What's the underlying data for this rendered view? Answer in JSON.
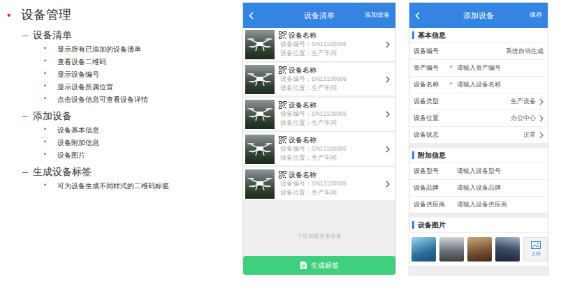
{
  "outline": {
    "bullet": "•",
    "title": "设备管理",
    "sections": [
      {
        "marker": "–",
        "title": "设备清单",
        "items": [
          {
            "bullet": "•",
            "text": "显示所有已添加的设备清单"
          },
          {
            "bullet": "•",
            "text": "查看设备二维码"
          },
          {
            "bullet": "•",
            "text": "显示设备编号"
          },
          {
            "bullet": "•",
            "text": "显示设备所属位置"
          },
          {
            "bullet": "•",
            "text": "点击设备信息可查看设备详情"
          }
        ]
      },
      {
        "marker": "–",
        "title": "添加设备",
        "items": [
          {
            "bullet": "•",
            "text": "设备基本信息"
          },
          {
            "bullet": "•",
            "text": "设备附加信息"
          },
          {
            "bullet": "•",
            "text": "设备图片"
          }
        ]
      },
      {
        "marker": "–",
        "title": "生成设备标签",
        "items": [
          {
            "bullet": "•",
            "text": "可为设备生成不同样式的二维码标签"
          }
        ]
      }
    ]
  },
  "list_screen": {
    "title": "设备清单",
    "action": "添加设备",
    "devices": [
      {
        "name": "设备名称",
        "number": "设备编号：SN13100006",
        "location": "设备位置：生产车间"
      },
      {
        "name": "设备名称",
        "number": "设备编号：SN13100006",
        "location": "设备位置：生产车间"
      },
      {
        "name": "设备名称",
        "number": "设备编号：SN13100006",
        "location": "设备位置：生产车间"
      },
      {
        "name": "设备名称",
        "number": "设备编号：SN13100006",
        "location": "设备位置：生产车间"
      },
      {
        "name": "设备名称",
        "number": "设备编号：SN13100006",
        "location": "设备位置：生产车间"
      }
    ],
    "load_more": "下拉加载更多设备",
    "button": "生成标签"
  },
  "add_screen": {
    "title": "添加设备",
    "action": "保存",
    "sections": [
      {
        "title": "基本信息",
        "kind": "fields",
        "fields": [
          {
            "label": "设备编号",
            "required": false,
            "kind": "static",
            "value": "系统自动生成"
          },
          {
            "label": "资产编号",
            "required": true,
            "mark": "*",
            "kind": "input",
            "placeholder": "请输入资产编号"
          },
          {
            "label": "设备名称",
            "required": true,
            "mark": "*",
            "kind": "input",
            "placeholder": "请输入设备名称"
          },
          {
            "label": "设备类型",
            "required": false,
            "kind": "select",
            "value": "生产设备"
          },
          {
            "label": "设备位置",
            "required": false,
            "kind": "select",
            "value": "办公中心"
          },
          {
            "label": "设备状态",
            "required": false,
            "kind": "select",
            "value": "正常"
          }
        ]
      },
      {
        "title": "附加信息",
        "kind": "fields",
        "fields": [
          {
            "label": "设备型号",
            "required": false,
            "kind": "input",
            "placeholder": "请输入设备型号"
          },
          {
            "label": "设备品牌",
            "required": false,
            "kind": "input",
            "placeholder": "请输入设备品牌"
          },
          {
            "label": "设备供应商",
            "required": false,
            "kind": "input",
            "placeholder": "请输入设备供应商"
          }
        ]
      },
      {
        "title": "设备图片",
        "kind": "tiles",
        "tiles": [
          {
            "kind": "photo"
          },
          {
            "kind": "photo"
          },
          {
            "kind": "photo"
          },
          {
            "kind": "photo"
          },
          {
            "kind": "upload",
            "label": "上传"
          }
        ]
      }
    ]
  }
}
